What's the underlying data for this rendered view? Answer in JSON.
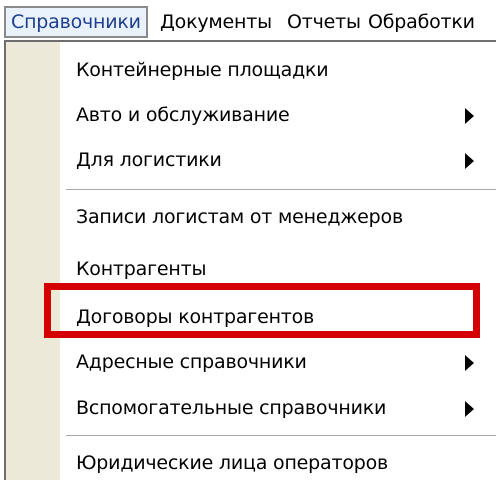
{
  "menubar": {
    "items": [
      {
        "label": "Справочники"
      },
      {
        "label": "Документы"
      },
      {
        "label": "Отчеты"
      },
      {
        "label": "Обработки"
      }
    ]
  },
  "dropdown": {
    "items": [
      {
        "label": "Контейнерные площадки",
        "submenu": false
      },
      {
        "label": "Авто и обслуживание",
        "submenu": true
      },
      {
        "label": "Для логистики",
        "submenu": true
      },
      {
        "label": "Записи логистам от менеджеров",
        "submenu": false
      },
      {
        "label": "Контрагенты",
        "submenu": false,
        "highlighted": true
      },
      {
        "label": "Договоры контрагентов",
        "submenu": false
      },
      {
        "label": "Адресные справочники",
        "submenu": true
      },
      {
        "label": "Вспомогательные справочники",
        "submenu": true
      },
      {
        "label": "Юридические лица операторов",
        "submenu": false
      }
    ]
  },
  "colors": {
    "highlight": "#d40000",
    "gutter": "#ece9d8",
    "active_menu_text": "#1e3f8f"
  },
  "icons": {
    "submenu_arrow": "chevron-right-icon"
  }
}
